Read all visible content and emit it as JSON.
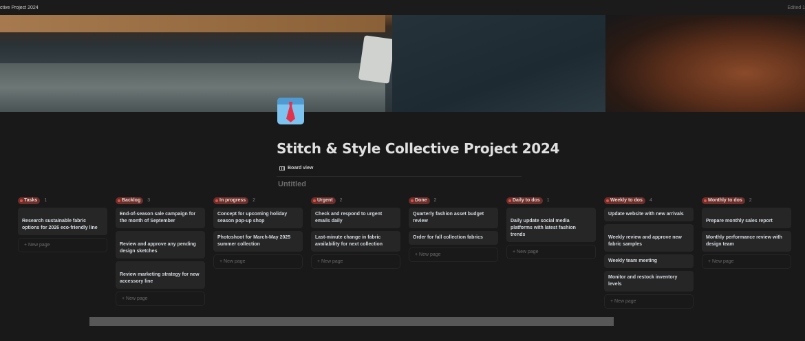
{
  "topbar": {
    "title": "ctive Project 2024",
    "edited": "Edited 1"
  },
  "page": {
    "title": "Stitch & Style Collective Project 2024",
    "icon": "necktie-icon",
    "view_tab": "Board view",
    "board_title": "Untitled"
  },
  "new_page_label": "New page",
  "colors": {
    "tag_bg": "#6e2f2a",
    "tag_dot": "#e0524a",
    "card_bg": "#262626",
    "bg": "#191919"
  },
  "columns": [
    {
      "name": "Tasks",
      "count": "1",
      "cards": [
        {
          "title": "Research sustainable fabric options for 2026 eco-friendly line",
          "gap": true
        }
      ]
    },
    {
      "name": "Backlog",
      "count": "3",
      "cards": [
        {
          "title": "End-of-season sale campaign for the month of September"
        },
        {
          "title": "Review and approve any pending design sketches",
          "gap": true
        },
        {
          "title": "Review marketing strategy for new accessory line",
          "gap": true
        }
      ]
    },
    {
      "name": "In progress",
      "count": "2",
      "cards": [
        {
          "title": "Concept for upcoming holiday season pop-up shop"
        },
        {
          "title": "Photoshoot for March-May 2025 summer collection"
        }
      ]
    },
    {
      "name": "Urgent",
      "count": "2",
      "cards": [
        {
          "title": "Check and respond to urgent emails daily"
        },
        {
          "title": "Last-minute change in fabric availability for next collection"
        }
      ]
    },
    {
      "name": "Done",
      "count": "2",
      "cards": [
        {
          "title": "Quarterly fashion asset budget review"
        },
        {
          "title": "Order for fall collection fabrics"
        }
      ]
    },
    {
      "name": "Daily to dos",
      "count": "1",
      "cards": [
        {
          "title": "Daily update social media platforms with latest fashion trends",
          "gap": true
        }
      ]
    },
    {
      "name": "Weekly to dos",
      "count": "4",
      "cards": [
        {
          "title": "Update website with new arrivals"
        },
        {
          "title": "Weekly review and approve new fabric samples",
          "gap": true
        },
        {
          "title": "Weekly team meeting"
        },
        {
          "title": "Monitor and restock inventory levels"
        }
      ]
    },
    {
      "name": "Monthly to dos",
      "count": "2",
      "cards": [
        {
          "title": "Prepare monthly sales report",
          "gap": true
        },
        {
          "title": "Monthly performance review with design team"
        }
      ]
    }
  ]
}
